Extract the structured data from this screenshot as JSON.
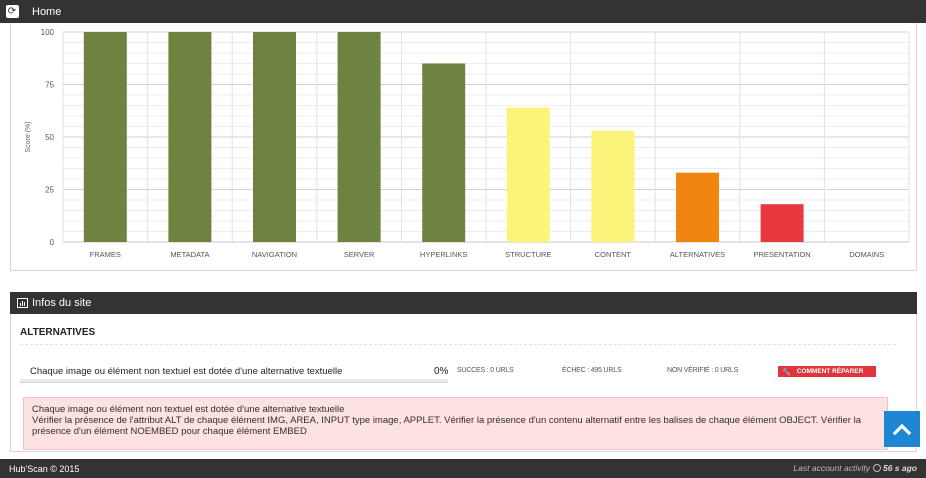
{
  "topbar": {
    "title": "Home",
    "refresh_icon": "refresh-icon"
  },
  "chart_data": {
    "type": "bar",
    "categories": [
      "FRAMES",
      "METADATA",
      "NAVIGATION",
      "SERVER",
      "HYPERLINKS",
      "STRUCTURE",
      "CONTENT",
      "ALTERNATIVES",
      "PRESENTATION",
      "DOMAINS"
    ],
    "values": [
      100,
      100,
      100,
      100,
      85,
      64,
      53,
      33,
      18,
      0
    ],
    "colors": [
      "#6f8340",
      "#6f8340",
      "#6f8340",
      "#6f8340",
      "#6f8340",
      "#fbf37a",
      "#fbf37a",
      "#f0850f",
      "#e8383f",
      "#6f8340"
    ],
    "ylabel": "Score (%)",
    "ylim": [
      0,
      100
    ],
    "yticks": [
      0,
      25,
      50,
      75,
      100
    ],
    "grid": true
  },
  "infos": {
    "header": "Infos du site",
    "section_title": "ALTERNATIVES",
    "criterion": "Chaque image ou élément non textuel est dotée d'une alternative textuelle",
    "percent": "0%",
    "progress": 0,
    "success": "SUCCES : 0 URLS",
    "failure": "ÉCHEC : 495 URLS",
    "unverified": "NON VÉRIFIÉ : 0 URLS",
    "fix_button": "COMMENT RÉPARER",
    "alert_title": "Chaque image ou élément non textuel est dotée d'une alternative textuelle",
    "alert_body": "Vérifier la présence de l'attribut ALT de chaque élément IMG, AREA, INPUT type image, APPLET. Vérifier la présence d'un contenu alternatif entre les balises de chaque élément OBJECT. Vérifier la présence d'un élément NOEMBED pour chaque élément EMBED"
  },
  "footer": {
    "copyright": "Hub'Scan © 2015",
    "activity_label": "Last account activity",
    "activity_value": "56 s ago"
  }
}
